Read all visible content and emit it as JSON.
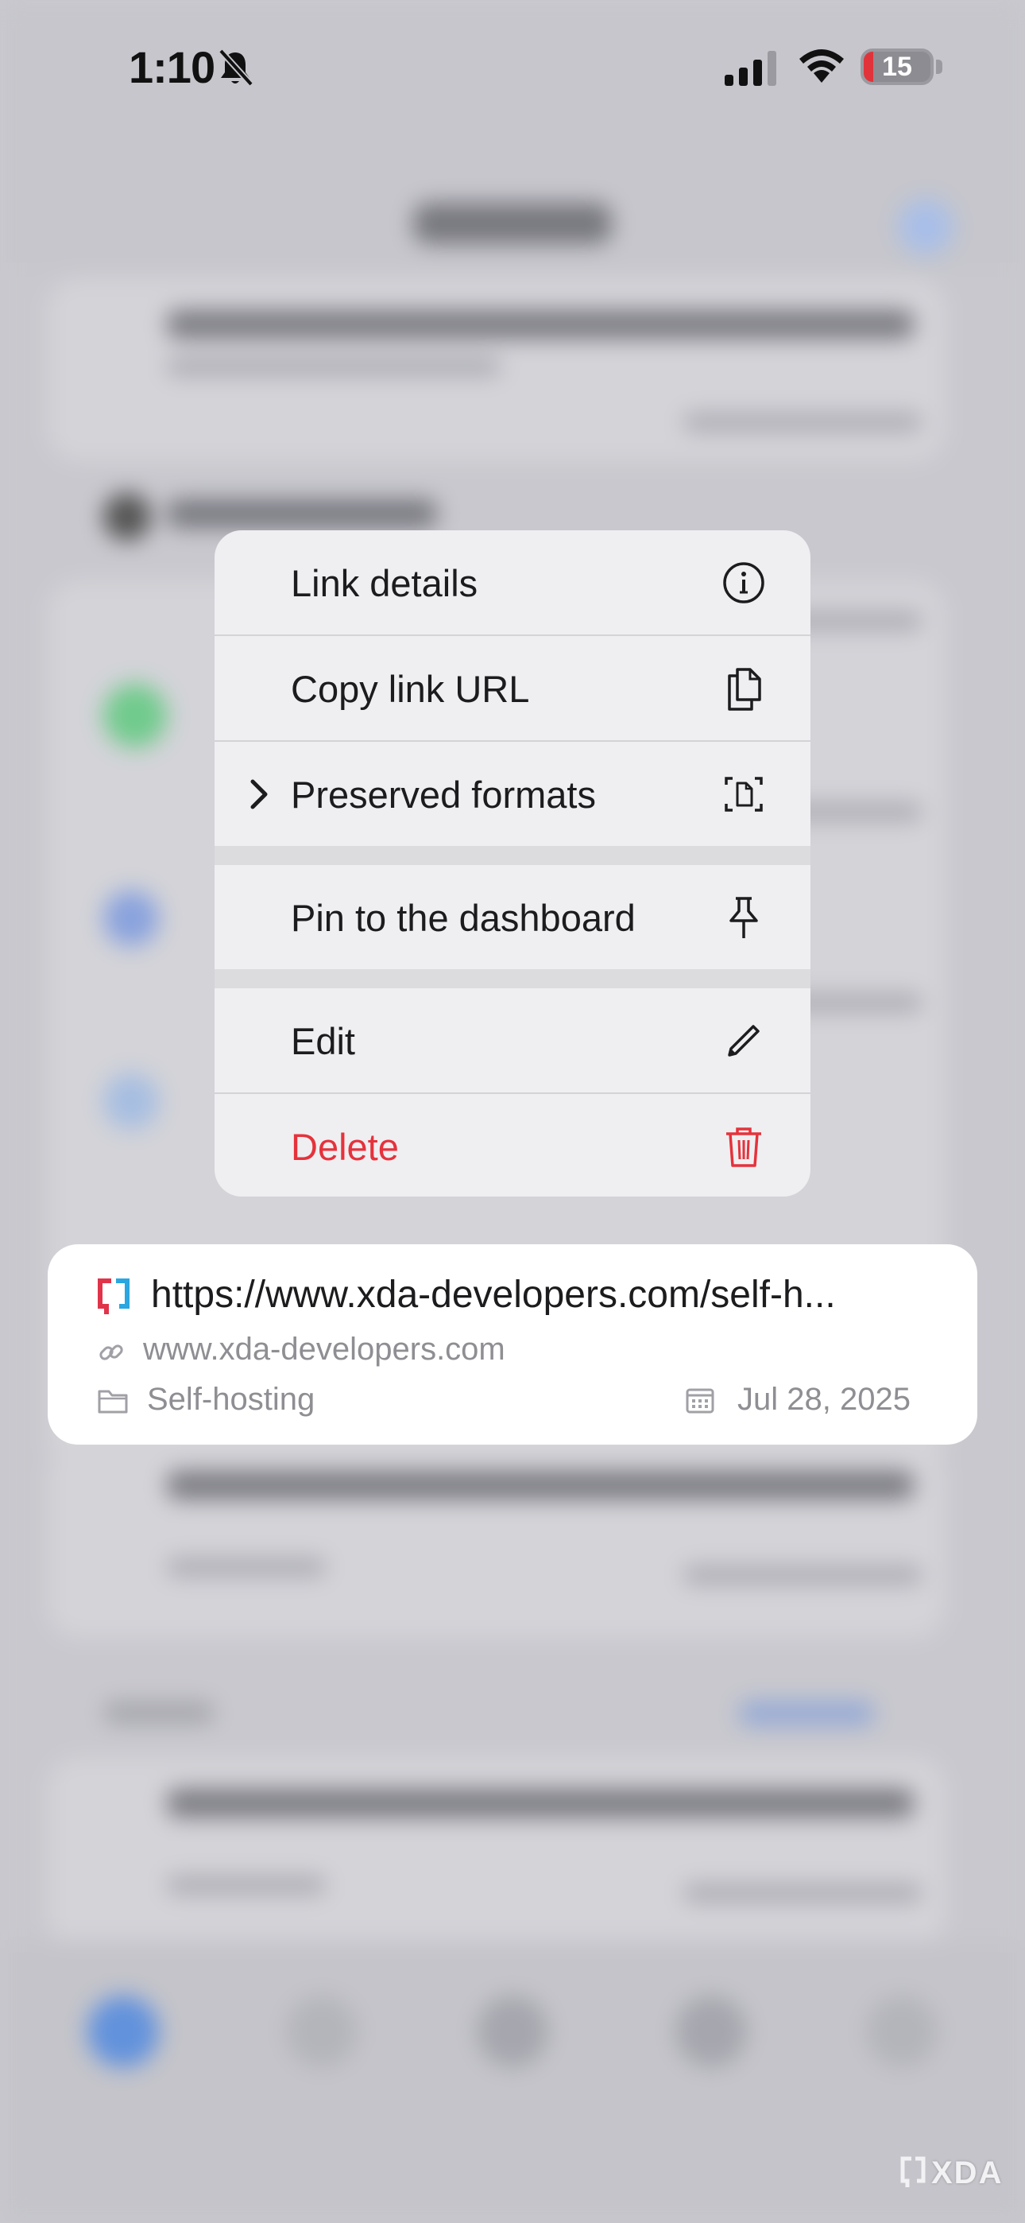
{
  "status_bar": {
    "time": "1:10",
    "battery": "15",
    "icons": [
      "bell-slash-icon",
      "cellular-signal-icon",
      "wifi-icon",
      "battery-icon"
    ]
  },
  "context_menu": {
    "items": [
      {
        "label": "Link details",
        "icon": "info-circle-icon"
      },
      {
        "label": "Copy link URL",
        "icon": "copy-documents-icon"
      },
      {
        "label": "Preserved formats",
        "icon": "document-viewfinder-icon",
        "has_submenu": true
      },
      {
        "label": "Pin to the dashboard",
        "icon": "pin-icon"
      },
      {
        "label": "Edit",
        "icon": "pencil-icon"
      },
      {
        "label": "Delete",
        "icon": "trash-icon",
        "destructive": true
      }
    ]
  },
  "preview_card": {
    "title": "https://www.xda-developers.com/self-h...",
    "domain": "www.xda-developers.com",
    "collection": "Self-hosting",
    "date": "Jul 28, 2025"
  },
  "watermark": {
    "text": "XDA"
  },
  "colors": {
    "destructive": "#e5323c",
    "menu_background": "#efeff1",
    "secondary_text": "#8e8e93",
    "brand_red": "#e0344a",
    "brand_blue": "#2aa6e0"
  }
}
